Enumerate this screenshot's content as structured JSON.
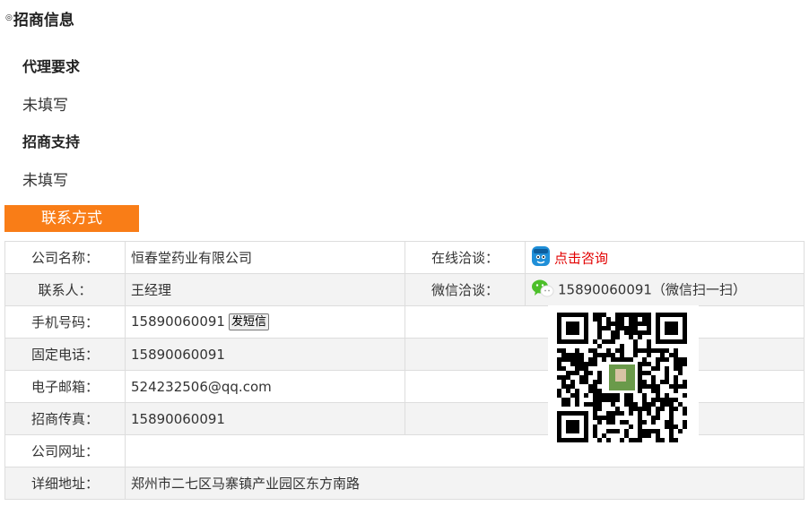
{
  "section": {
    "title": "招商信息",
    "marker": "◎"
  },
  "agent": {
    "heading": "代理要求",
    "text": "未填写"
  },
  "support": {
    "heading": "招商支持",
    "text": "未填写"
  },
  "contact_tab": "联系方式",
  "contact": {
    "company_label": "公司名称：",
    "company_value": "恒春堂药业有限公司",
    "online_label": "在线洽谈：",
    "online_link": "点击咨询",
    "person_label": "联系人：",
    "person_value": "王经理",
    "wechat_label": "微信洽谈：",
    "wechat_value": "15890060091（微信扫一扫）",
    "mobile_label": "手机号码：",
    "mobile_value": "15890060091",
    "sms_button": "发短信",
    "phone_label": "固定电话：",
    "phone_value": "15890060091",
    "email_label": "电子邮箱：",
    "email_value": "524232506@qq.com",
    "fax_label": "招商传真：",
    "fax_value": "15890060091",
    "website_label": "公司网址：",
    "website_value": "",
    "address_label": "详细地址：",
    "address_value": "郑州市二七区马寨镇产业园区东方南路"
  },
  "icons": {
    "online": "chat-avatar-icon",
    "wechat": "wechat-icon",
    "qr": "qr-code"
  },
  "colors": {
    "tab": "#f97d17",
    "link": "#e20000",
    "wechat": "#4cbf2a",
    "chat": "#1f8fd8"
  }
}
